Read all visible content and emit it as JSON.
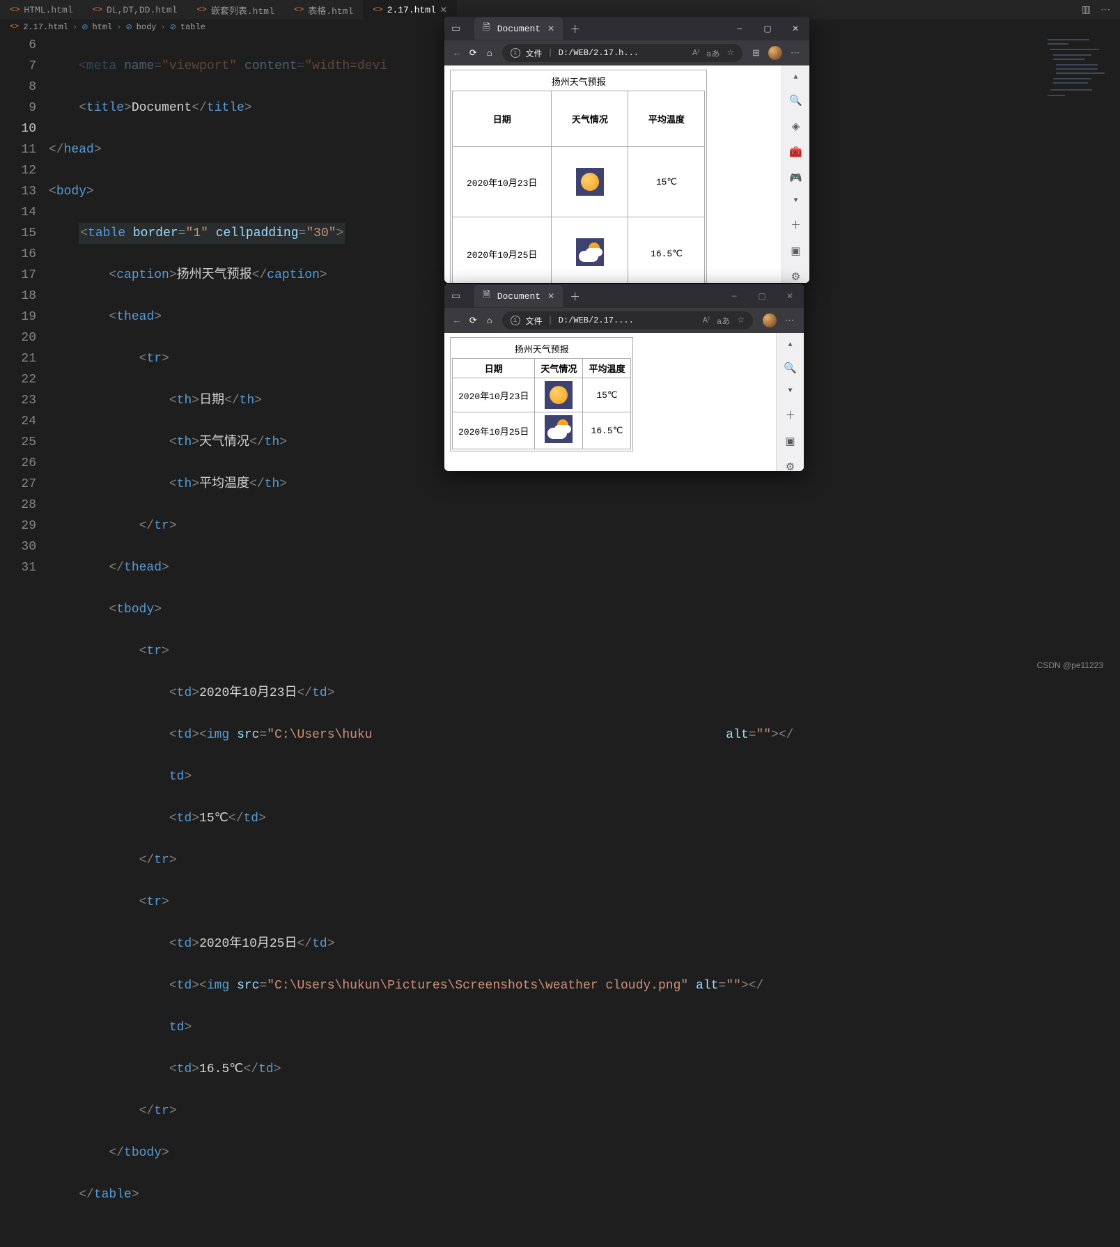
{
  "tabs": [
    "HTML.html",
    "DL,DT,DD.html",
    "嵌套列表.html",
    "表格.html",
    "2.17.html"
  ],
  "active_tab_index": 4,
  "breadcrumb": [
    "2.17.html",
    "html",
    "body",
    "table"
  ],
  "line_numbers": [
    "6",
    "7",
    "8",
    "9",
    "10",
    "11",
    "12",
    "13",
    "14",
    "15",
    "16",
    "17",
    "18",
    "19",
    "20",
    "21",
    "22",
    "23",
    "24",
    "25",
    "26",
    "27",
    "28",
    "29",
    "30",
    "31"
  ],
  "code": {
    "l6": "meta name=\"viewport\" content=\"width=devi…",
    "title_text": "Document",
    "border_val": "\"1\"",
    "cellpadding_val": "\"30\"",
    "caption_text": "扬州天气预报",
    "th1": "日期",
    "th2": "天气情况",
    "th3": "平均温度",
    "td_date1": "2020年10月23日",
    "td_temp1": "15℃",
    "td_date2": "2020年10月25日",
    "td_temp2": "16.5℃",
    "img_src1": "\"C:\\Users\\huku",
    "img_src2": "\"C:\\Users\\hukun\\Pictures\\Screenshots\\weather cloudy.png\"",
    "alt_val": "\"\"",
    "alt_label": "alt"
  },
  "browser1": {
    "tab_title": "Document",
    "url_prefix": "文件",
    "url": "D:/WEB/2.17.h...",
    "caption": "扬州天气预报",
    "headers": [
      "日期",
      "天气情况",
      "平均温度"
    ],
    "rows": [
      {
        "date": "2020年10月23日",
        "icon": "sun",
        "temp": "15℃"
      },
      {
        "date": "2020年10月25日",
        "icon": "cloudy",
        "temp": "16.5℃"
      }
    ]
  },
  "browser2": {
    "tab_title": "Document",
    "url_prefix": "文件",
    "url": "D:/WEB/2.17....",
    "caption": "扬州天气预报",
    "headers": [
      "日期",
      "天气情况",
      "平均温度"
    ],
    "rows": [
      {
        "date": "2020年10月23日",
        "icon": "sun",
        "temp": "15℃"
      },
      {
        "date": "2020年10月25日",
        "icon": "cloudy",
        "temp": "16.5℃"
      }
    ]
  },
  "watermark": "CSDN @pe11223"
}
